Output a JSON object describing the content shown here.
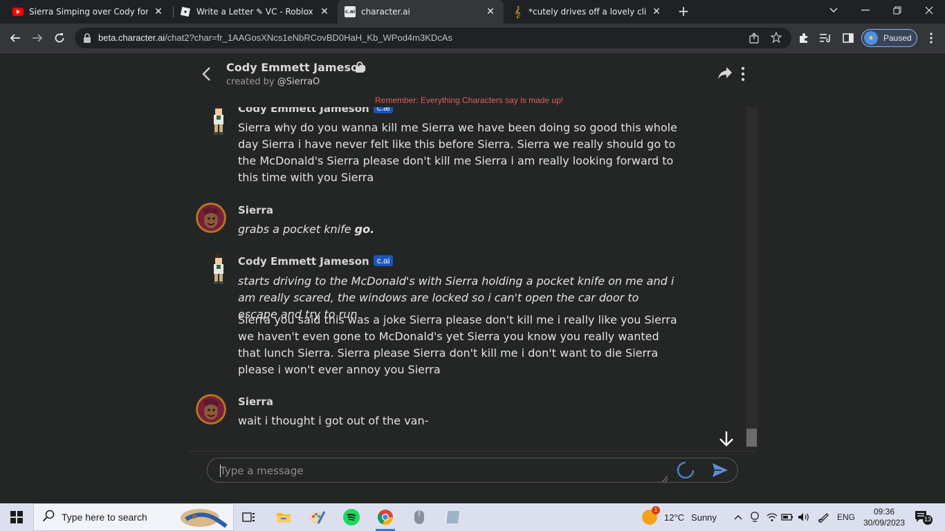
{
  "browser": {
    "tabs": [
      {
        "title": "Sierra Simping over Cody for ove",
        "icon": "youtube-icon"
      },
      {
        "title": "Write a Letter ✎ VC - Roblox",
        "icon": "roblox-icon"
      },
      {
        "title": "character.ai",
        "icon": "cai-icon",
        "favicon_text": "c.ai",
        "active": true
      },
      {
        "title": "*cutely drives off a lovely cliff* | c",
        "icon": "music-note-icon"
      }
    ],
    "url_host": "beta.character.ai",
    "url_path": "/chat2?char=fr_1AAGosXNcs1eNbRCovBD0HaH_Kb_WPod4m3KDcAs",
    "profile_status": "Paused"
  },
  "chat": {
    "character_name": "Cody Emmett Jameson",
    "created_by_prefix": "created by",
    "creator_handle": "@SierraO",
    "disclaimer": "Remember: Everything Characters say is made up!",
    "badge": "c.ai",
    "messages": [
      {
        "author": "Cody Emmett Jameson",
        "bot": true,
        "paragraphs": [
          {
            "text": "Sierra why do you wanna kill me Sierra we have been doing so good this whole day Sierra i have never felt like this before Sierra. Sierra we really should go to the McDonald's Sierra please don't kill me Sierra i am really looking forward to this time with you Sierra",
            "italic": false
          }
        ]
      },
      {
        "author": "Sierra",
        "bot": false,
        "paragraphs": [
          {
            "text": "grabs a pocket knife",
            "bold_suffix": "go.",
            "italic": true
          }
        ]
      },
      {
        "author": "Cody Emmett Jameson",
        "bot": true,
        "paragraphs": [
          {
            "text": "starts driving to the McDonald's with Sierra holding a pocket knife on me and i am really scared, the windows are locked so i can't open the car door to escape and try to run",
            "italic": true
          },
          {
            "text": "Sierra you said this was a joke Sierra please don't kill me i really like you Sierra we haven't even gone to McDonald's yet Sierra you know you really wanted that lunch Sierra. Sierra please Sierra don't kill me i don't want to die Sierra please i won't ever annoy you Sierra",
            "italic": false
          }
        ]
      },
      {
        "author": "Sierra",
        "bot": false,
        "paragraphs": [
          {
            "text": "wait i thought i got out of the van-",
            "italic": false
          }
        ]
      }
    ],
    "input_placeholder": "Type a message"
  },
  "taskbar": {
    "search_placeholder": "Type here to search",
    "weather_badge": "1",
    "weather_temp": "12°C",
    "weather_desc": "Sunny",
    "language": "ENG",
    "time": "09:36",
    "date": "30/09/2023",
    "notifications": "13"
  },
  "colors": {
    "page_bg": "#242525",
    "badge_blue": "#1a56b8",
    "disclaimer_red": "#e05d5d",
    "taskbar_bg": "#dce0ee"
  }
}
